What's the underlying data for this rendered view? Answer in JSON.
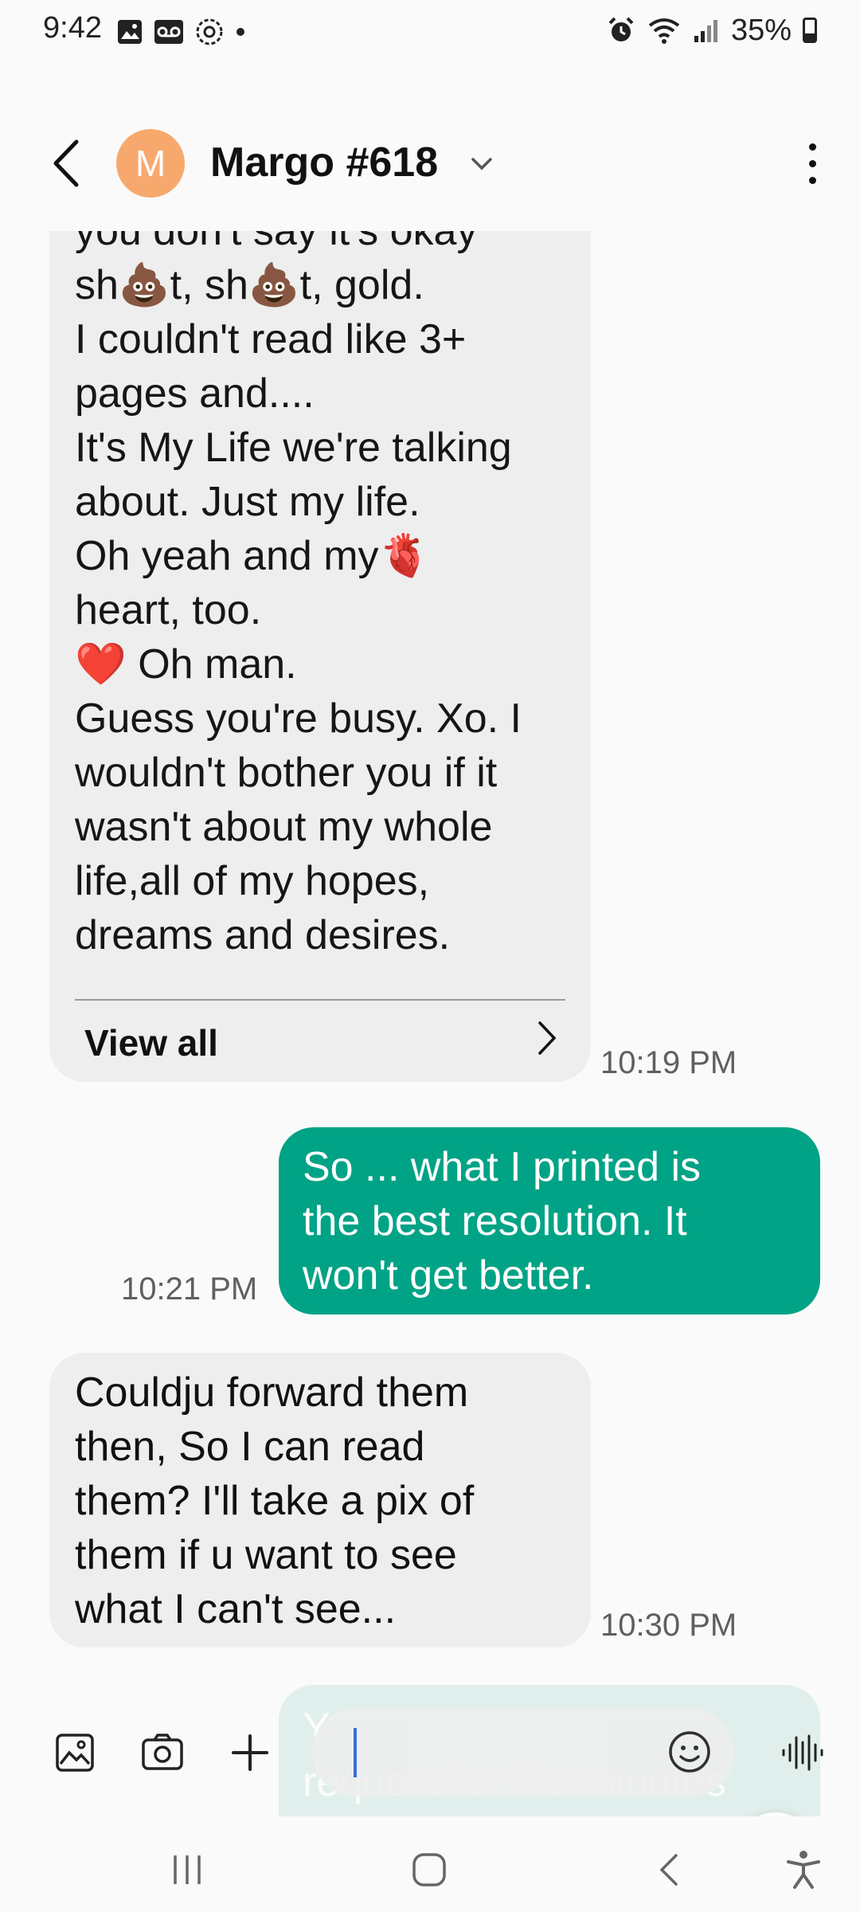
{
  "status_bar": {
    "time": "9:42",
    "battery_text": "35%",
    "battery_level": 0.35,
    "left_icons": [
      "image-icon",
      "voicemail-icon",
      "settings-badge-icon",
      "dot-icon"
    ],
    "right_icons": [
      "alarm-icon",
      "wifi-icon",
      "signal-icon",
      "battery-icon"
    ]
  },
  "header": {
    "avatar_initial": "M",
    "avatar_color": "#f7a96d",
    "contact_name": "Margo #618"
  },
  "messages": [
    {
      "direction": "incoming",
      "text": "you don't say it's okay\nsh💩t, sh💩t, gold.\nI couldn't read like 3+\npages and....\nIt's My Life we're talking\nabout. Just my life.\nOh yeah and my🫀\nheart, too.\n❤️ Oh man.\nGuess you're busy. Xo. I\nwouldn't bother you if it\nwasn't about my whole\nlife,all of my hopes,\ndreams and desires.",
      "view_all_label": "View all",
      "time": "10:19 PM"
    },
    {
      "direction": "outgoing",
      "text": "So ... what I printed is\nthe best resolution. It\nwon't get better.",
      "time": "10:21 PM"
    },
    {
      "direction": "incoming",
      "text": "Couldju forward them\nthen, So I can read\nthem? I'll take a pix of\nthem if u want to see\nwhat I can't see...",
      "time": "10:30 PM"
    },
    {
      "direction": "outgoing",
      "text": "Y\nrequest for the minutes",
      "partial": true
    }
  ],
  "compose": {
    "value": "",
    "placeholder": ""
  },
  "colors": {
    "outgoing_bubble": "#00a385",
    "incoming_bubble": "#eeeeee",
    "accent_cursor": "#2c64d8"
  }
}
